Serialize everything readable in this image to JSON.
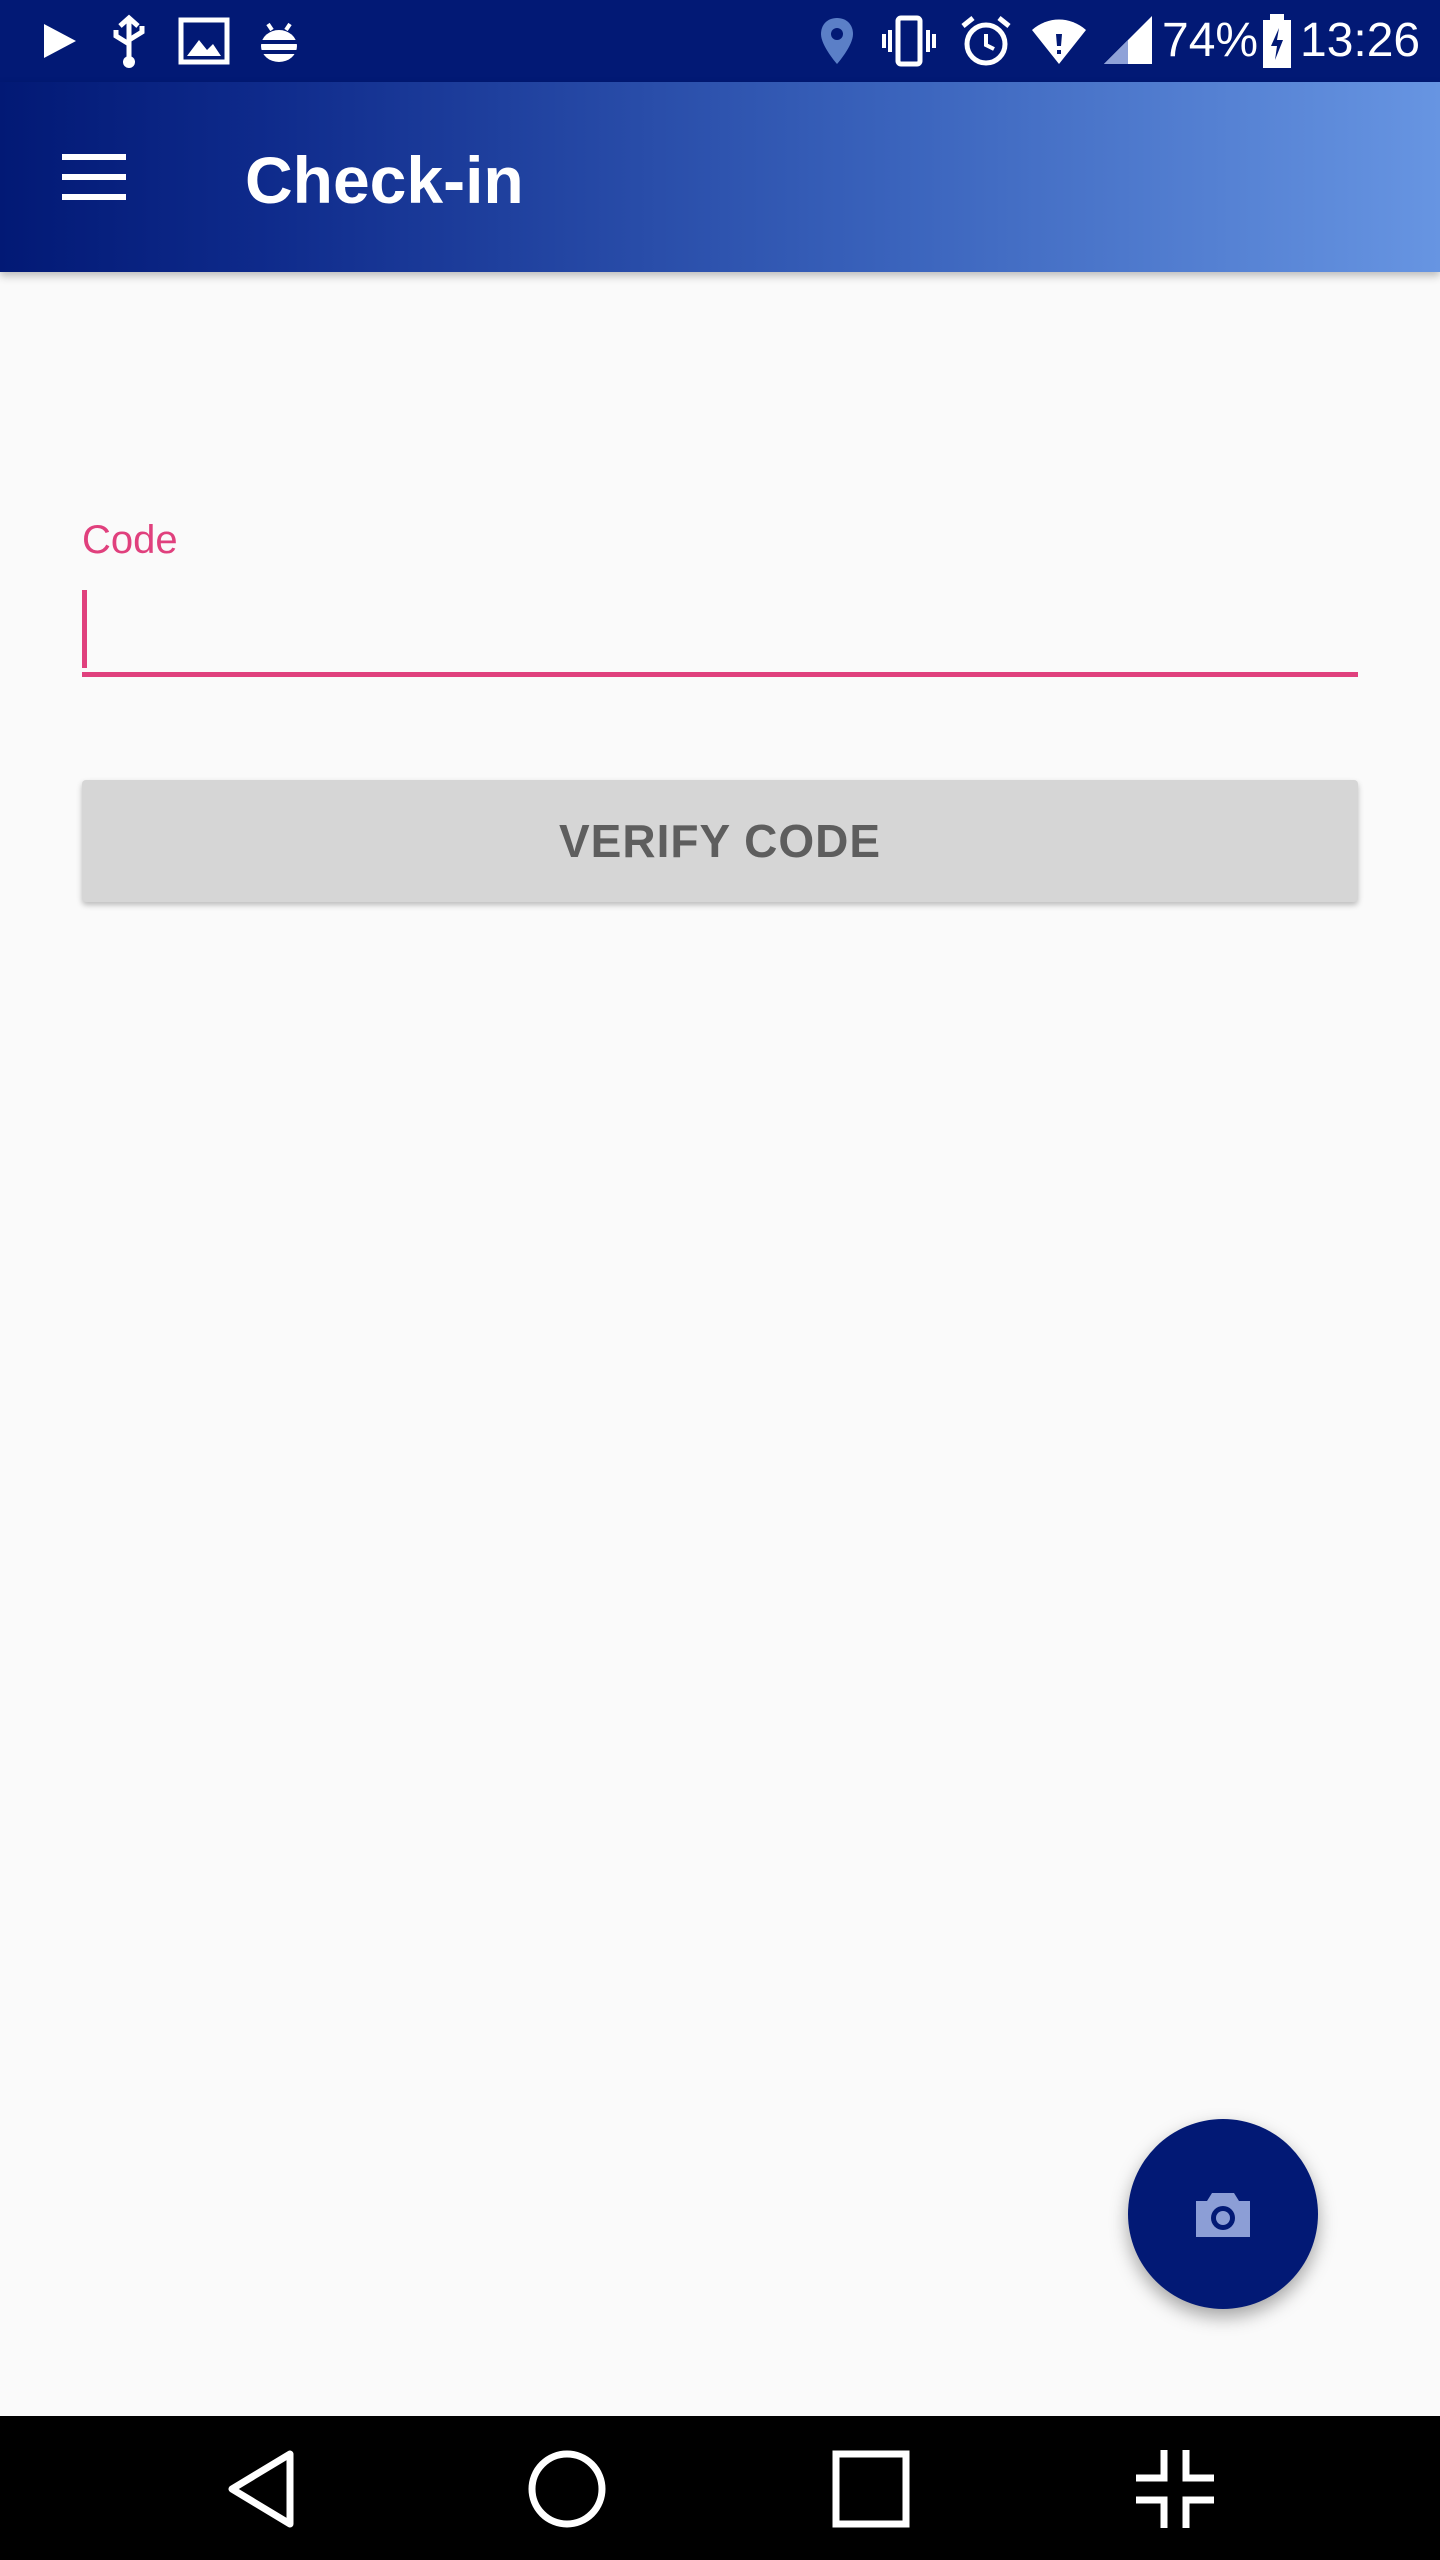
{
  "status_bar": {
    "icons": [
      "play-icon",
      "usb-icon",
      "image-icon",
      "android-debug-icon",
      "location-icon",
      "vibrate-icon",
      "alarm-icon",
      "wifi-icon",
      "signal-icon",
      "battery-icon"
    ],
    "battery_percent": "74%",
    "time": "13:26"
  },
  "app_bar": {
    "menu_icon": "hamburger-menu-icon",
    "title": "Check-in"
  },
  "form": {
    "code_label": "Code",
    "code_value": "",
    "verify_button_label": "VERIFY CODE"
  },
  "fab": {
    "icon": "camera-icon"
  },
  "nav_bar": {
    "icons": [
      "back-icon",
      "home-icon",
      "recents-icon",
      "exit-fullscreen-icon"
    ]
  },
  "colors": {
    "primary": "#021975",
    "accent": "#e0407d",
    "button_bg": "#d6d6d6",
    "background": "#fafafa"
  }
}
